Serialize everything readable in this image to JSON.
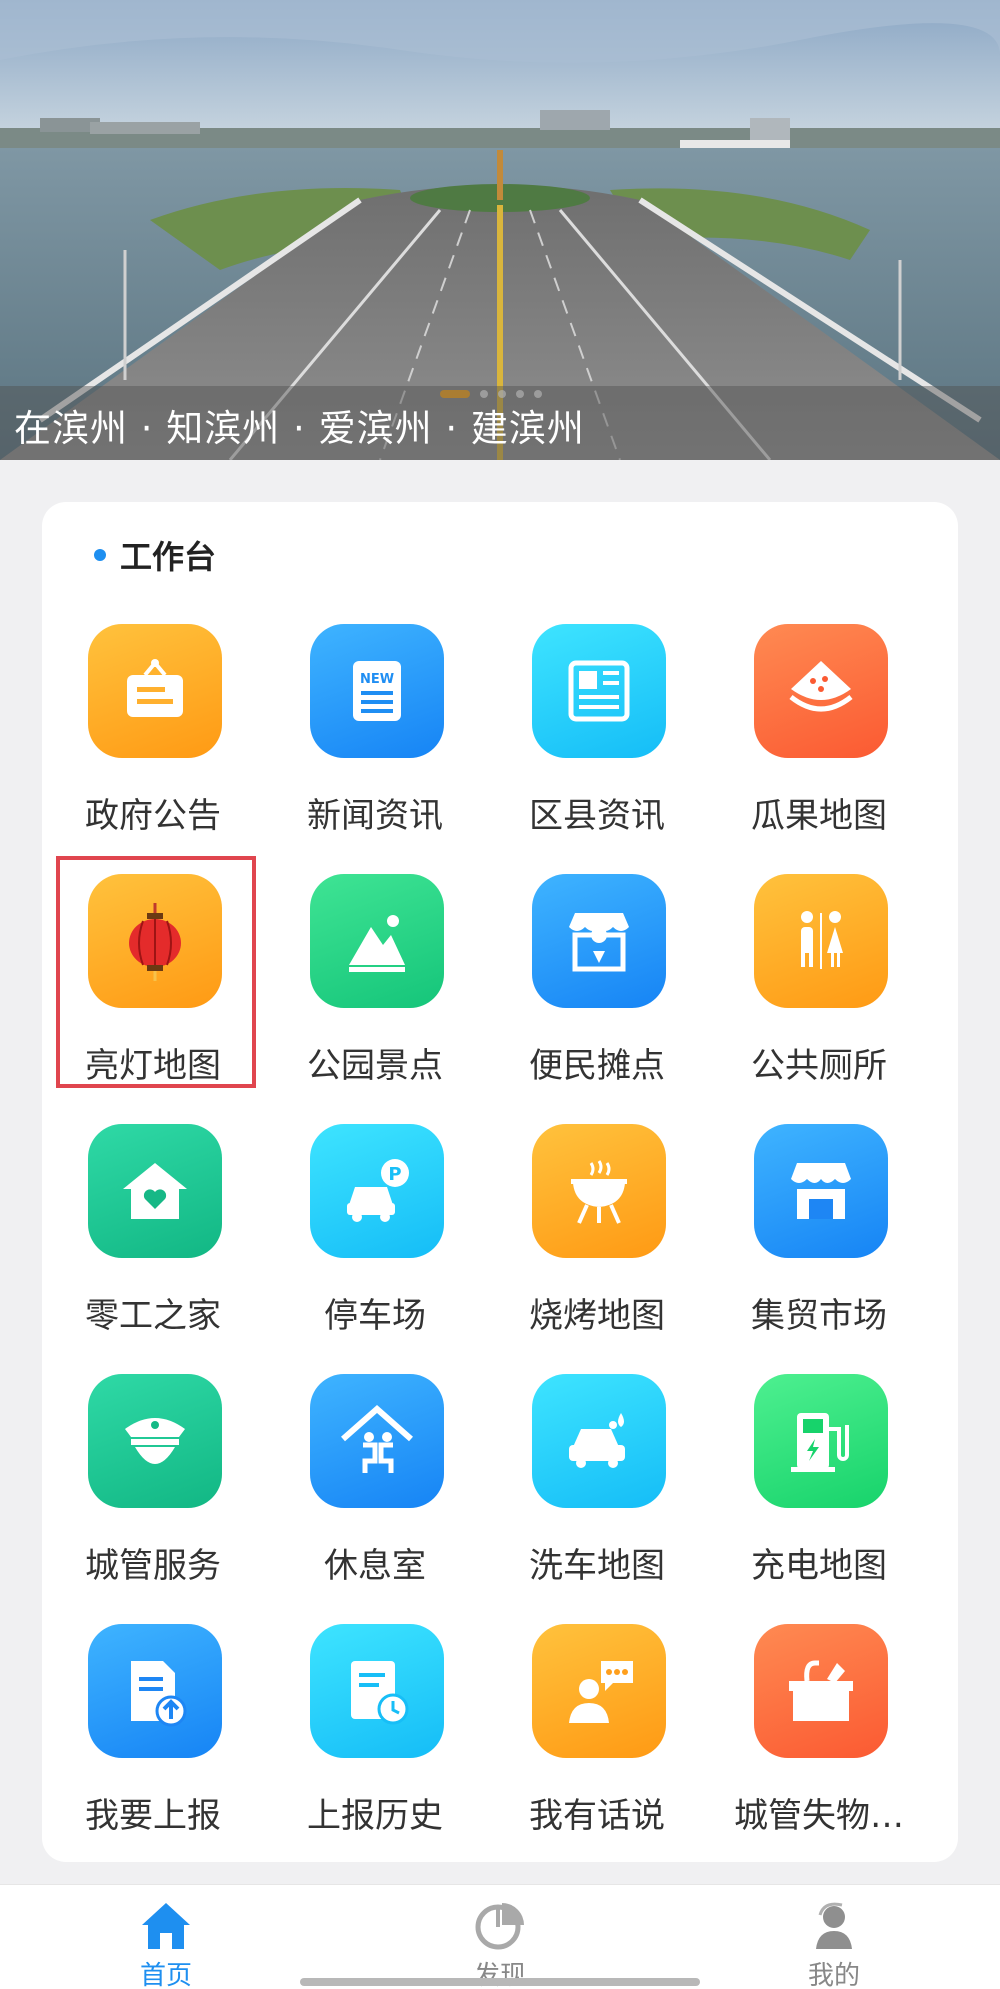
{
  "banner": {
    "caption": "在滨州 · 知滨州 · 爱滨州 · 建滨州",
    "slides": 5,
    "active_slide": 1
  },
  "workbench": {
    "title": "工作台",
    "items": [
      {
        "label": "政府公告",
        "icon": "notice-board-icon",
        "color": "orange"
      },
      {
        "label": "新闻资讯",
        "icon": "news-icon",
        "color": "blue"
      },
      {
        "label": "区县资讯",
        "icon": "newspaper-icon",
        "color": "cyan"
      },
      {
        "label": "瓜果地图",
        "icon": "watermelon-icon",
        "color": "red"
      },
      {
        "label": "亮灯地图",
        "icon": "lantern-icon",
        "color": "orange",
        "highlighted": true
      },
      {
        "label": "公园景点",
        "icon": "mountain-icon",
        "color": "green"
      },
      {
        "label": "便民摊点",
        "icon": "stall-icon",
        "color": "blue"
      },
      {
        "label": "公共厕所",
        "icon": "restroom-icon",
        "color": "orange"
      },
      {
        "label": "零工之家",
        "icon": "house-heart-icon",
        "color": "teal"
      },
      {
        "label": "停车场",
        "icon": "parking-icon",
        "color": "cyan"
      },
      {
        "label": "烧烤地图",
        "icon": "grill-icon",
        "color": "orange"
      },
      {
        "label": "集贸市场",
        "icon": "market-icon",
        "color": "blue"
      },
      {
        "label": "城管服务",
        "icon": "officer-icon",
        "color": "teal"
      },
      {
        "label": "休息室",
        "icon": "rest-room-icon",
        "color": "blue"
      },
      {
        "label": "洗车地图",
        "icon": "car-wash-icon",
        "color": "cyan"
      },
      {
        "label": "充电地图",
        "icon": "charging-icon",
        "color": "lime"
      },
      {
        "label": "我要上报",
        "icon": "report-upload-icon",
        "color": "blue"
      },
      {
        "label": "上报历史",
        "icon": "report-history-icon",
        "color": "cyan"
      },
      {
        "label": "我有话说",
        "icon": "speech-icon",
        "color": "orange"
      },
      {
        "label": "城管失物…",
        "icon": "lost-found-icon",
        "color": "red"
      }
    ]
  },
  "tabbar": {
    "home": "首页",
    "discover": "发现",
    "mine": "我的"
  },
  "colors": {
    "accent": "#1e8ff0",
    "highlight_border": "#e0454e"
  }
}
